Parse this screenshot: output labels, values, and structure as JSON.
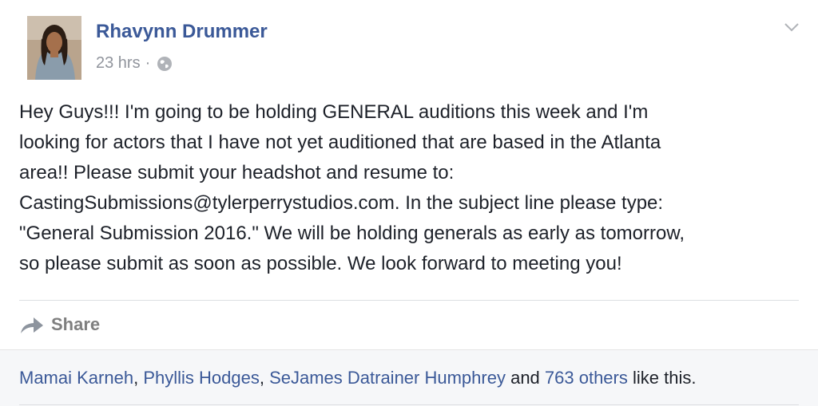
{
  "post": {
    "author": "Rhavynn Drummer",
    "time": "23 hrs",
    "separator": "·",
    "privacy_icon": "globe-icon",
    "text": "Hey Guys!!! I'm going to be holding GENERAL auditions this week and I'm\nlooking for actors that I have not yet auditioned that are based in the Atlanta\narea!! Please submit your headshot and resume to:\nCastingSubmissions@tylerperrystudios.com. In the subject line please type:\n\"General Submission 2016.\" We will be holding generals as early as tomorrow,\nso please submit as soon as possible. We look forward to meeting you!"
  },
  "actions": {
    "share_label": "Share"
  },
  "likes": {
    "name1": "Mamai Karneh",
    "sep1": ", ",
    "name2": "Phyllis Hodges",
    "sep2": ", ",
    "name3": "SeJames Datrainer Humphrey",
    "and": " and ",
    "others": "763 others",
    "tail": " like this."
  },
  "colors": {
    "link": "#3b5998",
    "meta": "#90949c",
    "share": "#7f7f7f",
    "likes_bg": "#f6f7f9"
  }
}
